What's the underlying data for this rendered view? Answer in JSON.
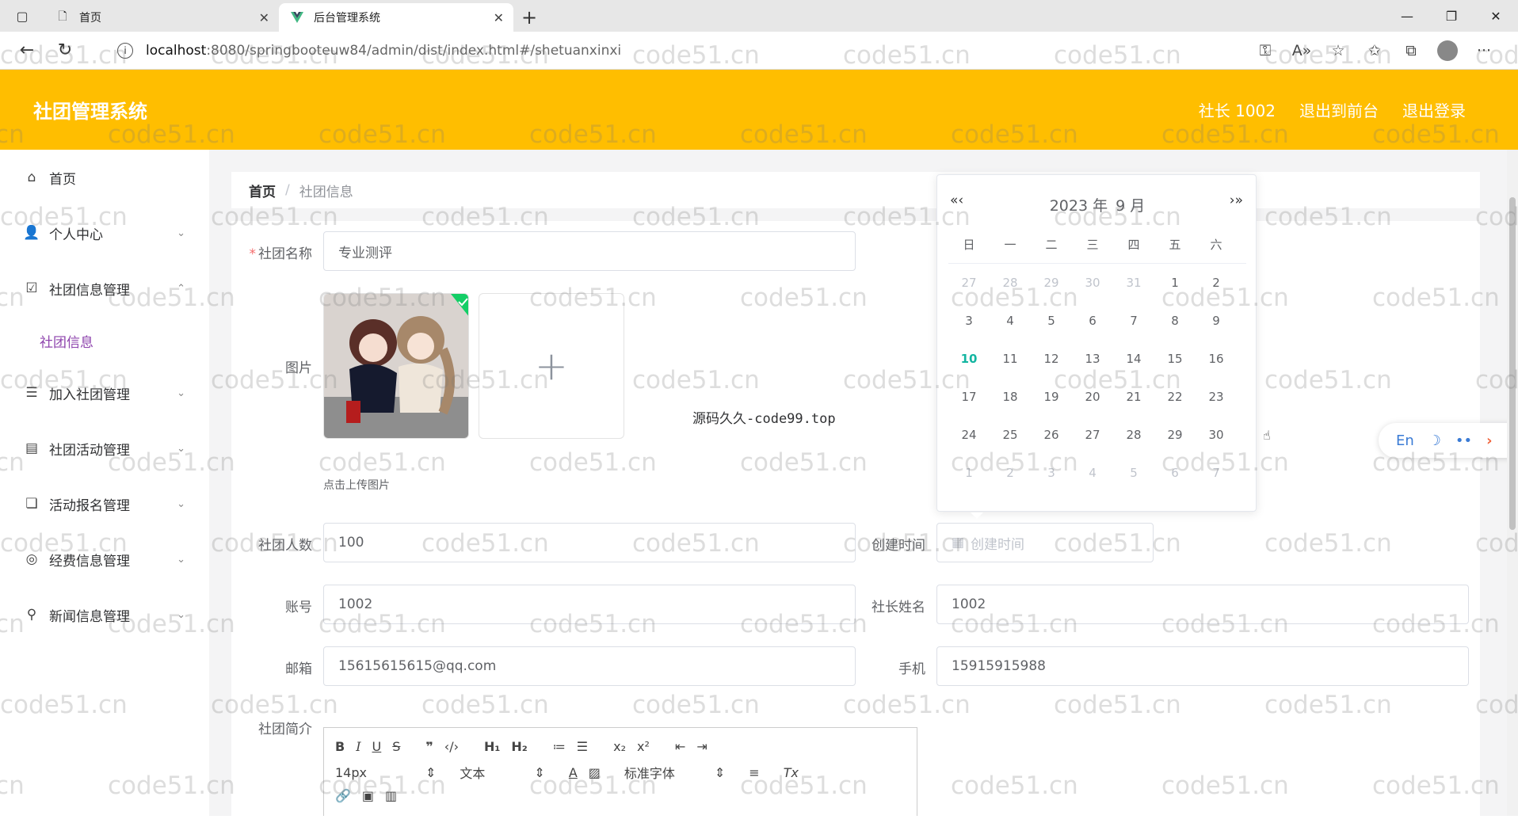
{
  "browser": {
    "tabs": [
      {
        "title": "首页",
        "active": false
      },
      {
        "title": "后台管理系统",
        "active": true
      }
    ],
    "url_host": "localhost",
    "url_path": ":8080/springbooteuw84/admin/dist/index.html#/shetuanxinxi"
  },
  "header": {
    "title": "社团管理系统",
    "links": [
      "社长 1002",
      "退出到前台",
      "退出登录"
    ],
    "color": "#ffbe00"
  },
  "sidebar": {
    "items": [
      {
        "label": "首页",
        "icon": "home-icon"
      },
      {
        "label": "个人中心",
        "icon": "user-icon"
      },
      {
        "label": "社团信息管理",
        "icon": "checkbox-icon",
        "sub": "社团信息"
      },
      {
        "label": "加入社团管理",
        "icon": "list-icon"
      },
      {
        "label": "社团活动管理",
        "icon": "document-icon"
      },
      {
        "label": "活动报名管理",
        "icon": "copy-icon"
      },
      {
        "label": "经费信息管理",
        "icon": "money-icon"
      },
      {
        "label": "新闻信息管理",
        "icon": "person-icon"
      }
    ]
  },
  "breadcrumb": {
    "home": "首页",
    "current": "社团信息"
  },
  "form": {
    "name_label": "社团名称",
    "name_value": "专业测评",
    "image_label": "图片",
    "upload_tip": "点击上传图片",
    "center_note": "源码久久-code99.top",
    "members_label": "社团人数",
    "members_value": "100",
    "created_label": "创建时间",
    "created_placeholder": "创建时间",
    "account_label": "账号",
    "account_value": "1002",
    "leader_label": "社长姓名",
    "leader_value": "1002",
    "email_label": "邮箱",
    "email_value": "15615615615@qq.com",
    "phone_label": "手机",
    "phone_value": "15915915988",
    "intro_label": "社团简介",
    "editor_fontsize": "14px",
    "editor_text": "文本",
    "editor_font": "标准字体"
  },
  "datepicker": {
    "title_year": "2023 年",
    "title_month": "9 月",
    "weekdays": [
      "日",
      "一",
      "二",
      "三",
      "四",
      "五",
      "六"
    ],
    "weeks": [
      [
        {
          "d": "27",
          "o": true
        },
        {
          "d": "28",
          "o": true
        },
        {
          "d": "29",
          "o": true
        },
        {
          "d": "30",
          "o": true
        },
        {
          "d": "31",
          "o": true
        },
        {
          "d": "1"
        },
        {
          "d": "2"
        }
      ],
      [
        {
          "d": "3"
        },
        {
          "d": "4"
        },
        {
          "d": "5"
        },
        {
          "d": "6"
        },
        {
          "d": "7"
        },
        {
          "d": "8"
        },
        {
          "d": "9"
        }
      ],
      [
        {
          "d": "10",
          "t": true
        },
        {
          "d": "11"
        },
        {
          "d": "12"
        },
        {
          "d": "13"
        },
        {
          "d": "14"
        },
        {
          "d": "15"
        },
        {
          "d": "16"
        }
      ],
      [
        {
          "d": "17"
        },
        {
          "d": "18"
        },
        {
          "d": "19"
        },
        {
          "d": "20"
        },
        {
          "d": "21"
        },
        {
          "d": "22"
        },
        {
          "d": "23"
        }
      ],
      [
        {
          "d": "24"
        },
        {
          "d": "25"
        },
        {
          "d": "26"
        },
        {
          "d": "27"
        },
        {
          "d": "28"
        },
        {
          "d": "29"
        },
        {
          "d": "30"
        }
      ],
      [
        {
          "d": "1",
          "o": true
        },
        {
          "d": "2",
          "o": true
        },
        {
          "d": "3",
          "o": true
        },
        {
          "d": "4",
          "o": true
        },
        {
          "d": "5",
          "o": true
        },
        {
          "d": "6",
          "o": true
        },
        {
          "d": "7",
          "o": true
        }
      ]
    ]
  },
  "float_tool": {
    "lang": "En"
  },
  "watermark": "code51.cn"
}
